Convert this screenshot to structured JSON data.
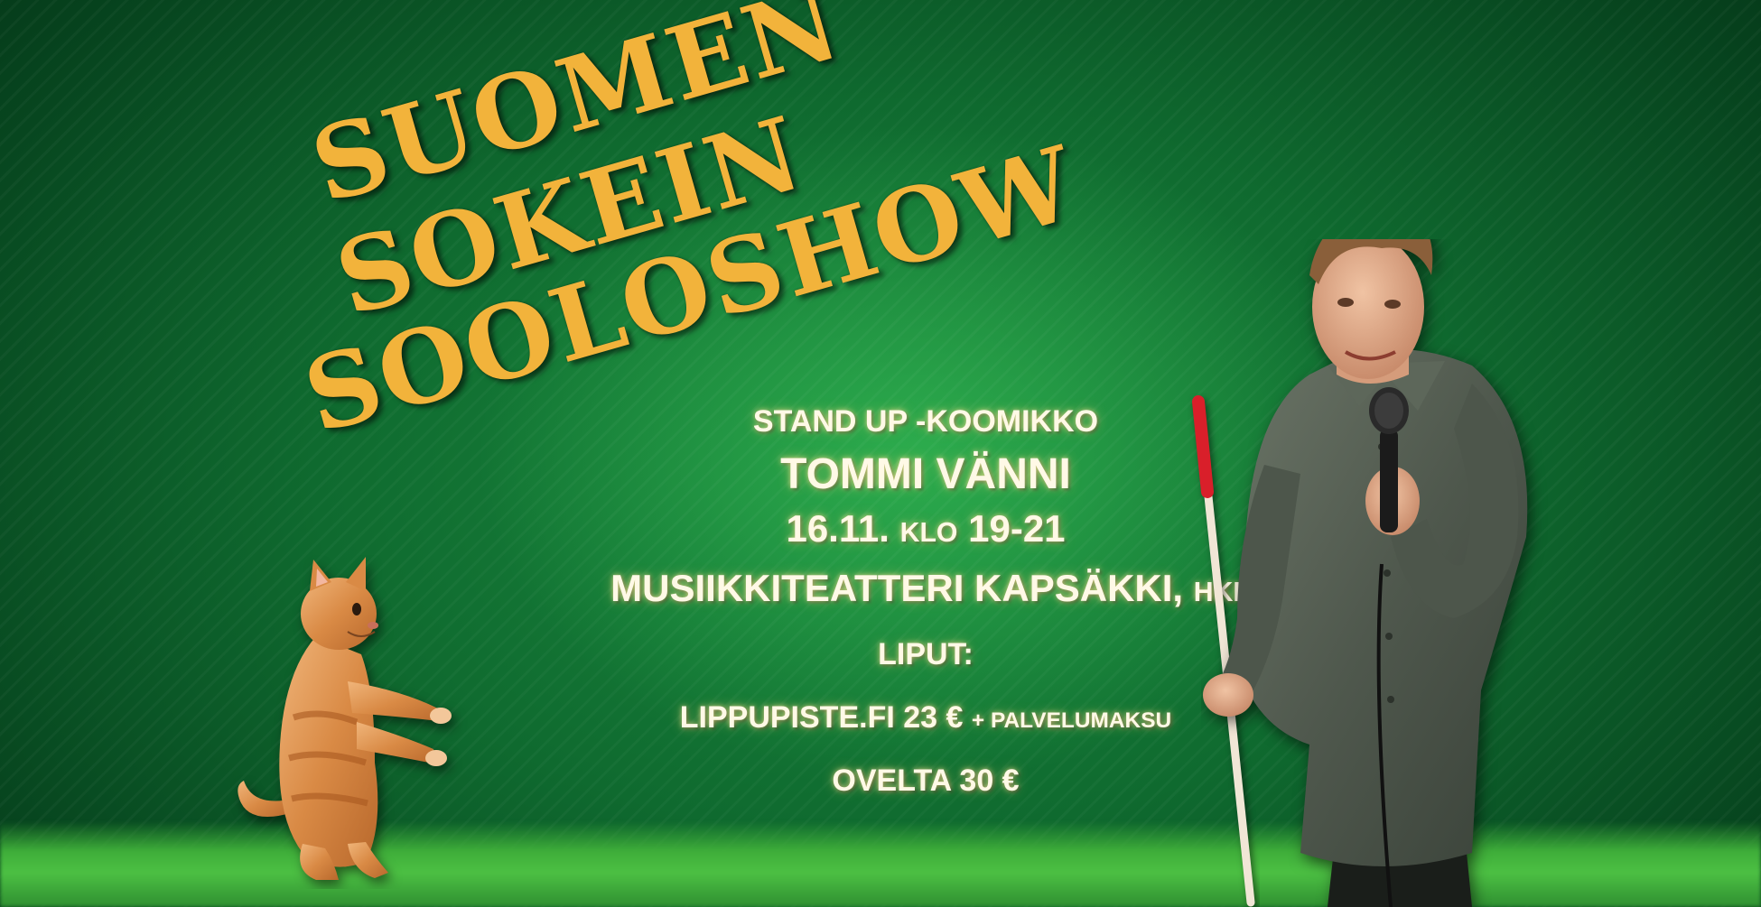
{
  "title": {
    "line1": "SUOMEN",
    "line2": "SOKEIN",
    "line3": "SOOLOSHOW"
  },
  "event": {
    "subtitle": "STAND UP -KOOMIKKO",
    "performer": "TOMMI VÄNNI",
    "date": "16.11.",
    "time_prefix": "KLO",
    "time": "19-21",
    "venue": "MUSIIKKITEATTERI KAPSÄKKI,",
    "city": "HKI",
    "tickets_label": "LIPUT:",
    "online_price": "LIPPUPISTE.FI 23 €",
    "online_fee": "+ PALVELUMAKSU",
    "door_price": "OVELTA 30 €"
  },
  "colors": {
    "title": "#f2b33b",
    "text": "#fff9e6",
    "background": "#0f6a2f"
  },
  "icons": {
    "cat": "cat-illustration",
    "performer": "performer-with-microphone",
    "cane": "white-cane"
  }
}
